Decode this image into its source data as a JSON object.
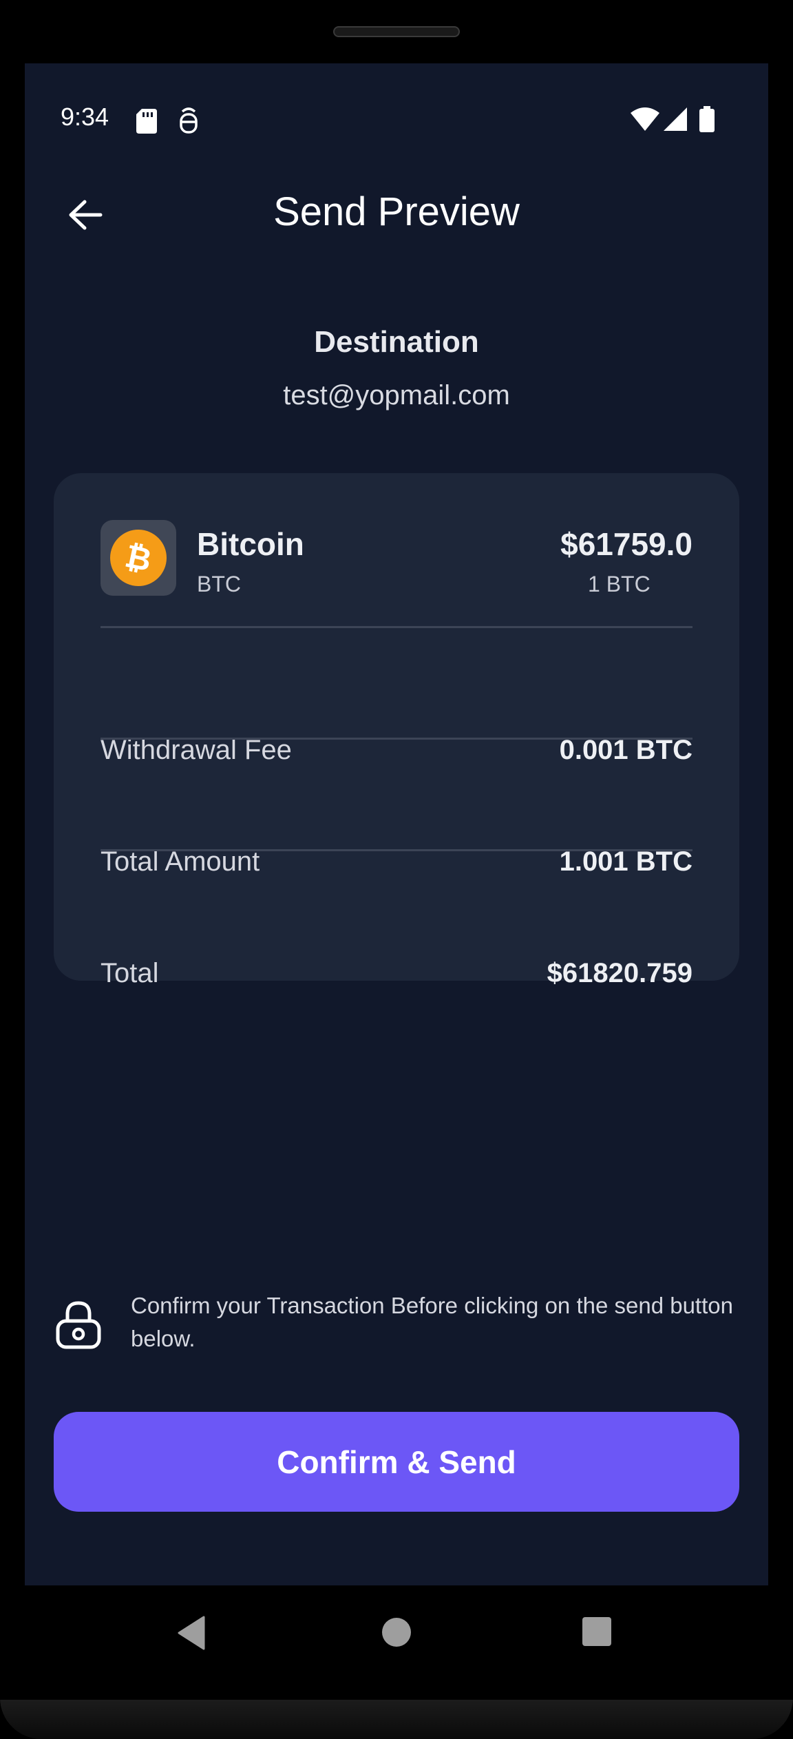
{
  "status_bar": {
    "time": "9:34"
  },
  "header": {
    "title": "Send Preview"
  },
  "destination": {
    "label": "Destination",
    "value": "test@yopmail.com"
  },
  "coin": {
    "name": "Bitcoin",
    "symbol": "BTC",
    "price": "$61759.0",
    "unit": "1 BTC",
    "icon_glyph": "₿",
    "icon_color": "#f59c17"
  },
  "rows": [
    {
      "label": "Withdrawal Fee",
      "value": "0.001 BTC"
    },
    {
      "label": "Total Amount",
      "value": "1.001 BTC"
    },
    {
      "label": "Total",
      "value": "$61820.759"
    }
  ],
  "note": {
    "text": "Confirm your Transaction Before clicking on the send button below."
  },
  "confirm_button": {
    "label": "Confirm & Send",
    "color": "#6c57f6"
  },
  "colors": {
    "background": "#11182b",
    "card": "#1d2639"
  }
}
